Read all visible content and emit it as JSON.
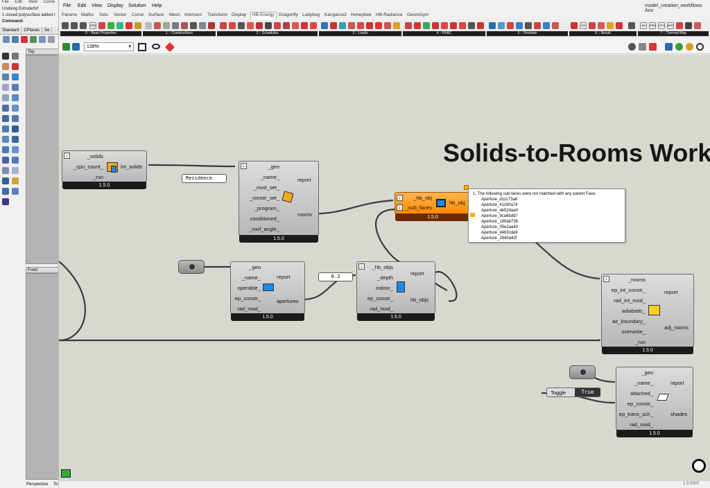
{
  "rhino": {
    "menu": [
      "File",
      "Edit",
      "View",
      "Curve"
    ],
    "command_history": [
      "Undoing ExtrudeSrf",
      "1 closed polysurface added t"
    ],
    "command_label": "Command:",
    "toolbar_tabs": [
      "Standard",
      "CPlanes",
      "Se"
    ],
    "viewports": [
      "Top",
      "Front",
      "Perspective",
      "To"
    ]
  },
  "gh": {
    "window_title": "model_creation_workflows Anu",
    "menu": [
      "File",
      "Edit",
      "View",
      "Display",
      "Solution",
      "Help"
    ],
    "tabs": [
      "Params",
      "Maths",
      "Sets",
      "Vector",
      "Curve",
      "Surface",
      "Mesh",
      "Intersect",
      "Transform",
      "Display",
      "HB-Energy",
      "Dragonfly",
      "Ladybug",
      "Kangaroo2",
      "Honeybee",
      "HB-Radiance",
      "GeomGym"
    ],
    "active_tab": "HB-Energy",
    "ribbon_groups": [
      "0 :: Basic Properties",
      "1 :: Constructions",
      "2 :: Schedules",
      "3 :: Loads",
      "4 :: HVAC",
      "5 :: Simulate",
      "6 :: Result",
      "7 :: Thermal Map"
    ],
    "ribbon_icon_labels": [
      "ORG",
      "123",
      "AD",
      "PMV",
      "UTCI",
      "MRT"
    ],
    "zoom": "138%",
    "version": "1.0.0007"
  },
  "canvas": {
    "title": "Solids-to-Rooms Work",
    "component_version": "1.5.0",
    "solids_comp": {
      "inputs": [
        "_solids",
        "_cpu_count_",
        "_run"
      ],
      "outputs": [
        "int_solids"
      ]
    },
    "room_comp": {
      "inputs": [
        "_geo",
        "_name_",
        "_mod_set_",
        "_constr_set_",
        "_program_",
        "conditioned_",
        "_roof_angle_"
      ],
      "outputs": [
        "report",
        "rooms"
      ]
    },
    "residence_panel": "Residence",
    "subface_comp": {
      "inputs": [
        "_hb_obj",
        "_sub_faces"
      ],
      "outputs": [
        "hb_obj"
      ]
    },
    "aperture_comp": {
      "inputs": [
        "_geo",
        "_name_",
        "operable_",
        "ep_constr_",
        "rad_mod_"
      ],
      "outputs": [
        "report",
        "apertures"
      ]
    },
    "depth_panel": "0.3",
    "extrude_comp": {
      "inputs": [
        "_hb_objs",
        "_depth",
        "indoor_",
        "ep_constr_",
        "rad_mod_"
      ],
      "outputs": [
        "report",
        "hb_objs"
      ]
    },
    "adjacency_comp": {
      "inputs": [
        "_rooms",
        "ep_int_constr_",
        "rad_int_mod_",
        "adiabatic_",
        "air_boundary_",
        "overwrite_",
        "_run"
      ],
      "outputs": [
        "report",
        "adj_rooms"
      ]
    },
    "shade_comp": {
      "inputs": [
        "_geo",
        "_name_",
        "attached_",
        "ep_constr_",
        "ep_trans_sch_",
        "rad_mod_"
      ],
      "outputs": [
        "report",
        "shades"
      ]
    },
    "toggle": {
      "label": "Toggle",
      "value": "True"
    },
    "warning": {
      "header": "1. The following sub-faces were not matched with any parent Face:",
      "items": [
        "Aperture_d11c73a6",
        "Aperture_41190a74",
        "Aperture_de524aa0",
        "Aperture_bca6bdd7",
        "Aperture_199ab736",
        "Aperture_05e2aa40",
        "Aperture_d463cde6",
        "Aperture_2840a42f"
      ]
    }
  },
  "colors": {
    "canvas": "#d8d8d0",
    "component": "#c8c8c8",
    "warning_component": "#ff9a1a",
    "version_bar": "#1b1b1b"
  }
}
